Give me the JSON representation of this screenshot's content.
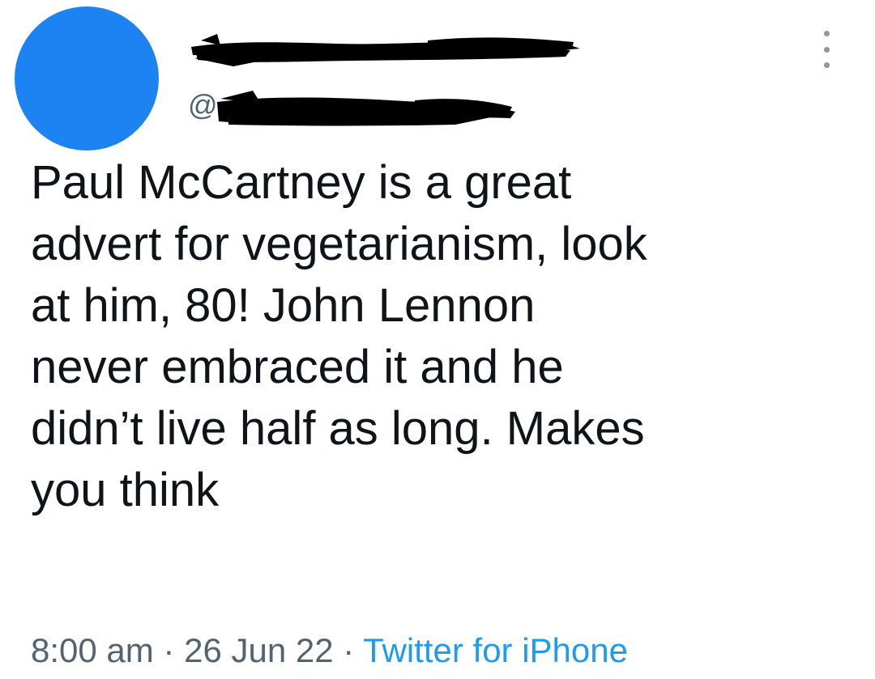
{
  "author": {
    "handle_prefix": "@",
    "avatar_color": "#1d83f2"
  },
  "tweet": {
    "text_lines": [
      "Paul McCartney is a great",
      "advert for vegetarianism, look",
      "at him, 80! John Lennon",
      "never embraced it and he",
      "didn’t live half as long. Makes",
      "you think"
    ],
    "time": "8:00 am",
    "separator_1": " · ",
    "date": "26 Jun 22",
    "separator_2": " · ",
    "source": "Twitter for iPhone"
  },
  "icons": {
    "more": "more-vertical-icon"
  },
  "colors": {
    "link": "#1d9bf0",
    "meta": "#536471",
    "text": "#0f1419",
    "redaction": "#000000"
  }
}
